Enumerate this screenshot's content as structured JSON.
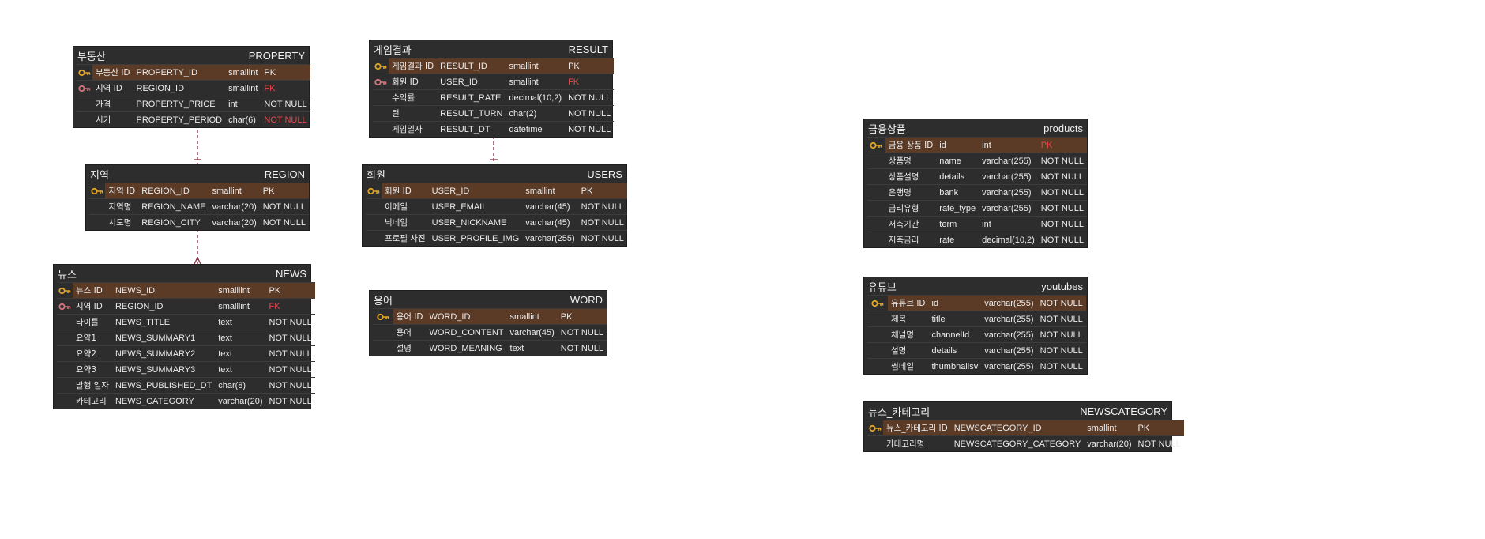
{
  "entities": {
    "property": {
      "logical": "부동산",
      "physical": "PROPERTY",
      "rows": [
        {
          "key": "pk",
          "label": "부동산 ID",
          "column": "PROPERTY_ID",
          "type": "smallint",
          "constraint": "PK"
        },
        {
          "key": "fk",
          "label": "지역 ID",
          "column": "REGION_ID",
          "type": "smallint",
          "constraint": "FK"
        },
        {
          "key": "",
          "label": "가격",
          "column": "PROPERTY_PRICE",
          "type": "int",
          "constraint": "NOT NULL"
        },
        {
          "key": "",
          "label": "시기",
          "column": "PROPERTY_PERIOD",
          "type": "char(6)",
          "constraint": "NOT NULL"
        }
      ]
    },
    "region": {
      "logical": "지역",
      "physical": "REGION",
      "rows": [
        {
          "key": "pk",
          "label": "지역 ID",
          "column": "REGION_ID",
          "type": "smallint",
          "constraint": "PK"
        },
        {
          "key": "",
          "label": "지역명",
          "column": "REGION_NAME",
          "type": "varchar(20)",
          "constraint": "NOT NULL"
        },
        {
          "key": "",
          "label": "시도명",
          "column": "REGION_CITY",
          "type": "varchar(20)",
          "constraint": "NOT NULL"
        }
      ]
    },
    "news": {
      "logical": "뉴스",
      "physical": "NEWS",
      "rows": [
        {
          "key": "pk",
          "label": "뉴스 ID",
          "column": "NEWS_ID",
          "type": "smalllint",
          "constraint": "PK"
        },
        {
          "key": "fk",
          "label": "지역 ID",
          "column": "REGION_ID",
          "type": "smalllint",
          "constraint": "FK"
        },
        {
          "key": "",
          "label": "타이틀",
          "column": "NEWS_TITLE",
          "type": "text",
          "constraint": "NOT NULL"
        },
        {
          "key": "",
          "label": "요약1",
          "column": "NEWS_SUMMARY1",
          "type": "text",
          "constraint": "NOT NULL"
        },
        {
          "key": "",
          "label": "요약2",
          "column": "NEWS_SUMMARY2",
          "type": "text",
          "constraint": "NOT NULL"
        },
        {
          "key": "",
          "label": "요약3",
          "column": "NEWS_SUMMARY3",
          "type": "text",
          "constraint": "NOT NULL"
        },
        {
          "key": "",
          "label": "발행 일자",
          "column": "NEWS_PUBLISHED_DT",
          "type": "char(8)",
          "constraint": "NOT NULL"
        },
        {
          "key": "",
          "label": "카테고리",
          "column": "NEWS_CATEGORY",
          "type": "varchar(20)",
          "constraint": "NOT NULL"
        }
      ]
    },
    "result": {
      "logical": "게임결과",
      "physical": "RESULT",
      "rows": [
        {
          "key": "pk",
          "label": "게임결과 ID",
          "column": "RESULT_ID",
          "type": "smallint",
          "constraint": "PK"
        },
        {
          "key": "fk",
          "label": "회원 ID",
          "column": "USER_ID",
          "type": "smallint",
          "constraint": "FK"
        },
        {
          "key": "",
          "label": "수익률",
          "column": "RESULT_RATE",
          "type": "decimal(10,2)",
          "constraint": "NOT NULL"
        },
        {
          "key": "",
          "label": "턴",
          "column": "RESULT_TURN",
          "type": "char(2)",
          "constraint": "NOT NULL"
        },
        {
          "key": "",
          "label": "게임일자",
          "column": "RESULT_DT",
          "type": "datetime",
          "constraint": "NOT NULL"
        }
      ]
    },
    "users": {
      "logical": "회원",
      "physical": "USERS",
      "rows": [
        {
          "key": "pk",
          "label": "회원 ID",
          "column": "USER_ID",
          "type": "smallint",
          "constraint": "PK"
        },
        {
          "key": "",
          "label": "이메일",
          "column": "USER_EMAIL",
          "type": "varchar(45)",
          "constraint": "NOT NULL"
        },
        {
          "key": "",
          "label": "닉네임",
          "column": "USER_NICKNAME",
          "type": "varchar(45)",
          "constraint": "NOT NULL"
        },
        {
          "key": "",
          "label": "프로필 사진",
          "column": "USER_PROFILE_IMG",
          "type": "varchar(255)",
          "constraint": "NOT NULL"
        }
      ]
    },
    "word": {
      "logical": "용어",
      "physical": "WORD",
      "rows": [
        {
          "key": "pk",
          "label": "용어 ID",
          "column": "WORD_ID",
          "type": "smallint",
          "constraint": "PK"
        },
        {
          "key": "",
          "label": "용어",
          "column": "WORD_CONTENT",
          "type": "varchar(45)",
          "constraint": "NOT NULL"
        },
        {
          "key": "",
          "label": "설명",
          "column": "WORD_MEANING",
          "type": "text",
          "constraint": "NOT NULL"
        }
      ]
    },
    "products": {
      "logical": "금융상품",
      "physical": "products",
      "rows": [
        {
          "key": "pk",
          "label": "금융 상품 ID",
          "column": "id",
          "type": "int",
          "constraint": "PK"
        },
        {
          "key": "",
          "label": "상품명",
          "column": "name",
          "type": "varchar(255)",
          "constraint": "NOT NULL"
        },
        {
          "key": "",
          "label": "상품설명",
          "column": "details",
          "type": "varchar(255)",
          "constraint": "NOT NULL"
        },
        {
          "key": "",
          "label": "은행명",
          "column": "bank",
          "type": "varchar(255)",
          "constraint": "NOT NULL"
        },
        {
          "key": "",
          "label": "금리유형",
          "column": "rate_type",
          "type": "varchar(255)",
          "constraint": "NOT NULL"
        },
        {
          "key": "",
          "label": "저축기간",
          "column": "term",
          "type": "int",
          "constraint": "NOT NULL"
        },
        {
          "key": "",
          "label": "저축금리",
          "column": "rate",
          "type": "decimal(10,2)",
          "constraint": "NOT NULL"
        }
      ]
    },
    "youtubes": {
      "logical": "유튜브",
      "physical": "youtubes",
      "rows": [
        {
          "key": "pk",
          "label": "유튜브 ID",
          "column": "id",
          "type": "varchar(255)",
          "constraint": "NOT NULL"
        },
        {
          "key": "",
          "label": "제목",
          "column": "title",
          "type": "varchar(255)",
          "constraint": "NOT NULL"
        },
        {
          "key": "",
          "label": "채널명",
          "column": "channelId",
          "type": "varchar(255)",
          "constraint": "NOT NULL"
        },
        {
          "key": "",
          "label": "설명",
          "column": "details",
          "type": "varchar(255)",
          "constraint": "NOT NULL"
        },
        {
          "key": "",
          "label": "썸네일",
          "column": "thumbnailsv",
          "type": "varchar(255)",
          "constraint": "NOT NULL"
        }
      ]
    },
    "newscategory": {
      "logical": "뉴스_카테고리",
      "physical": "NEWSCATEGORY",
      "rows": [
        {
          "key": "pk",
          "label": "뉴스_카테고리 ID",
          "column": "NEWSCATEGORY_ID",
          "type": "smallint",
          "constraint": "PK"
        },
        {
          "key": "",
          "label": "카테고리명",
          "column": "NEWSCATEGORY_CATEGORY",
          "type": "varchar(20)",
          "constraint": "NOT NULL"
        }
      ]
    }
  },
  "colors": {
    "entity_bg": "#2d2d2d",
    "pk_row": "#5b3a26",
    "pk_icon": "#e0a526",
    "fk_icon": "#d8747e",
    "red_text": "#e8474a",
    "relation_line": "#8b3a4a"
  }
}
